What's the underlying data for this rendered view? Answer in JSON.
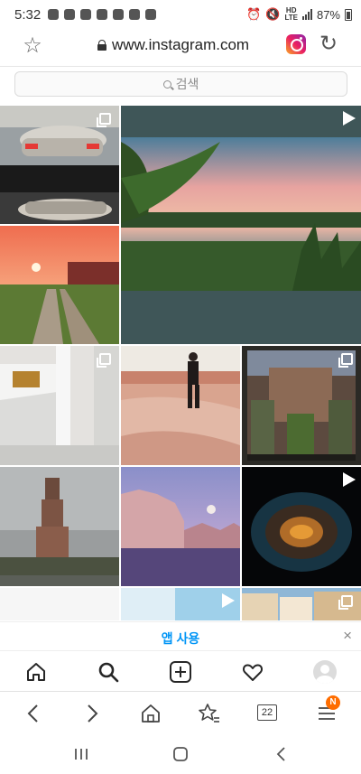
{
  "status_bar": {
    "time": "5:32",
    "network_top": "HD",
    "network_bottom": "LTE",
    "battery": "87%"
  },
  "browser": {
    "url": "www.instagram.com",
    "bookmark_icon": "star-icon",
    "reload_icon": "reload-icon"
  },
  "search": {
    "placeholder": "검색"
  },
  "banner": {
    "label": "앱 사용",
    "close": "×"
  },
  "toolbar": {
    "tab_count": "22",
    "badge": "N"
  },
  "colors": {
    "accent": "#0095f6",
    "badge": "#ff6d00"
  }
}
